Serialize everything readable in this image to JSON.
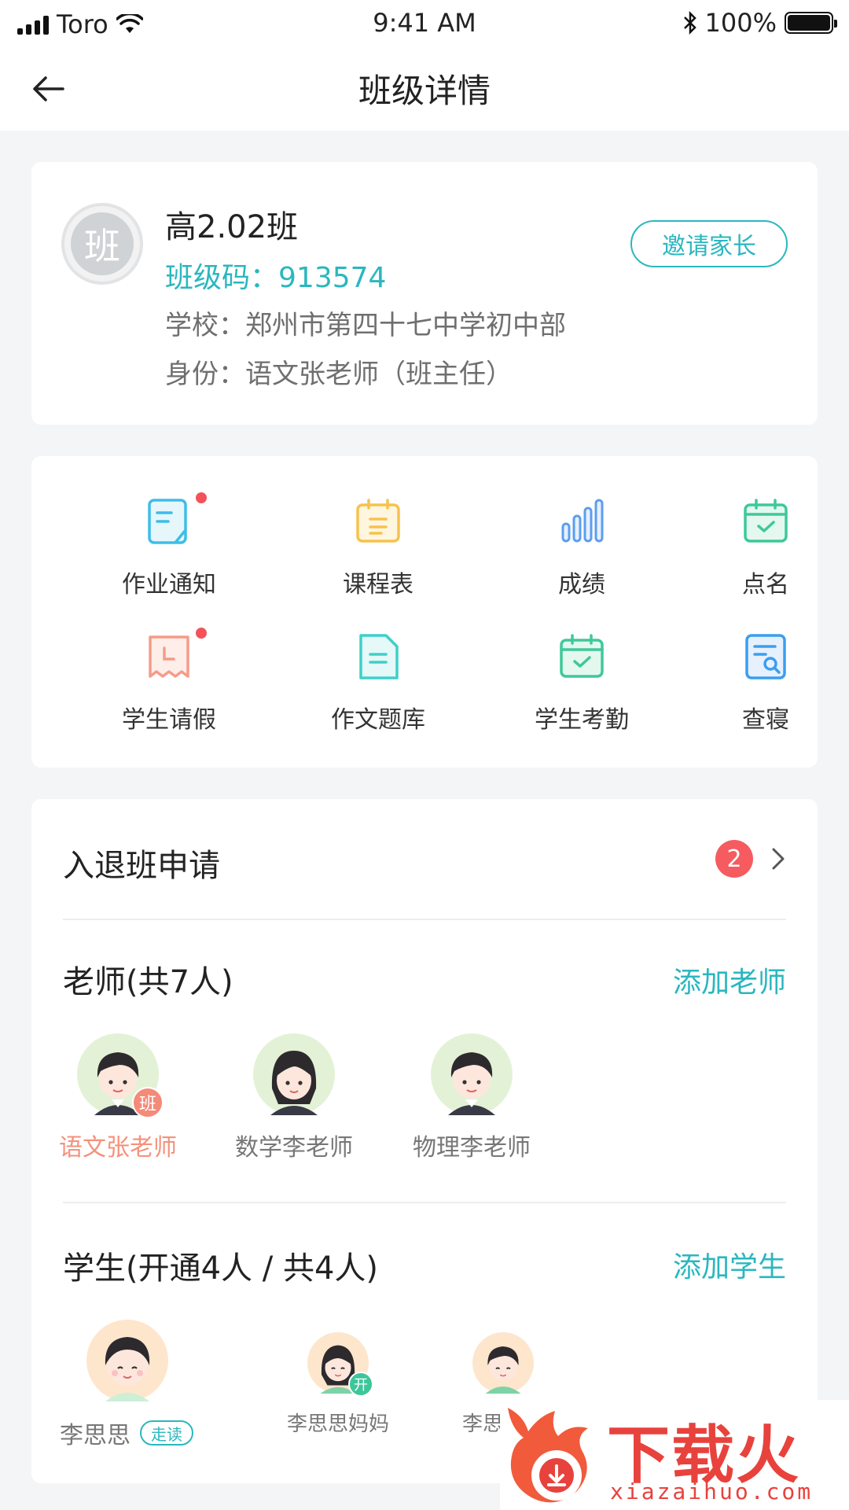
{
  "status_bar": {
    "carrier": "Toro",
    "time": "9:41 AM",
    "battery": "100%"
  },
  "nav": {
    "title": "班级详情"
  },
  "class_info": {
    "logo_char": "班",
    "name": "高2.02班",
    "code_label": "班级码：",
    "code_value": "913574",
    "school": "学校：郑州市第四十七中学初中部",
    "identity": "身份：语文张老师（班主任）",
    "invite_label": "邀请家长"
  },
  "functions": [
    {
      "label": "作业通知",
      "icon": "homework-icon",
      "color": "#3dbde8",
      "dot": true
    },
    {
      "label": "课程表",
      "icon": "schedule-icon",
      "color": "#f7c24d",
      "dot": false
    },
    {
      "label": "成绩",
      "icon": "grades-icon",
      "color": "#5b9ef0",
      "dot": false
    },
    {
      "label": "点名",
      "icon": "rollcall-icon",
      "color": "#3fc89a",
      "dot": false
    },
    {
      "label": "学生请假",
      "icon": "leave-icon",
      "color": "#f59c88",
      "dot": true
    },
    {
      "label": "作文题库",
      "icon": "essay-bank-icon",
      "color": "#3fcfc9",
      "dot": false
    },
    {
      "label": "学生考勤",
      "icon": "attendance-icon",
      "color": "#3fc89a",
      "dot": false
    },
    {
      "label": "查寝",
      "icon": "dorm-check-icon",
      "color": "#3b9ef0",
      "dot": false
    }
  ],
  "apply": {
    "label": "入退班申请",
    "count": "2"
  },
  "teachers": {
    "title": "老师(共7人)",
    "action": "添加老师",
    "items": [
      {
        "name": "语文张老师",
        "badge": "班",
        "active": true,
        "gender": "male"
      },
      {
        "name": "数学李老师",
        "badge": "",
        "active": false,
        "gender": "female"
      },
      {
        "name": "物理李老师",
        "badge": "",
        "active": false,
        "gender": "male"
      }
    ]
  },
  "students": {
    "title": "学生(开通4人 / 共4人)",
    "action": "添加学生",
    "items": [
      {
        "name": "李思思",
        "tag": "走读"
      },
      {
        "name": "李思思妈妈",
        "badge": "开"
      },
      {
        "name": "李思思爸"
      }
    ]
  },
  "watermark": {
    "text": "下载火",
    "url": "xiazaihuo.com"
  }
}
